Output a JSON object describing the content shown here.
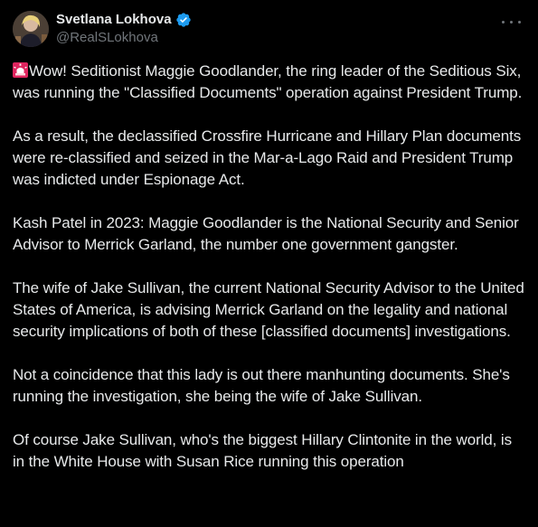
{
  "author": {
    "display_name": "Svetlana Lokhova",
    "handle": "@RealSLokhova",
    "verified": true,
    "avatar_icon": "profile-photo-icon",
    "verified_icon": "verified-badge-icon"
  },
  "menu": {
    "icon": "more-options-icon"
  },
  "colors": {
    "background": "#000000",
    "text": "#e7e9ea",
    "secondary_text": "#71767b",
    "verified_blue": "#1d9bf0",
    "siren_red": "#e0245e"
  },
  "tweet": {
    "lead_icon": "siren-icon",
    "paragraphs": [
      "Wow! Seditionist Maggie Goodlander, the ring leader of the Seditious Six, was running the \"Classified Documents\" operation against President Trump.",
      "As a result, the declassified Crossfire Hurricane and Hillary Plan documents were re-classified and seized in the Mar-a-Lago Raid and President Trump was indicted under Espionage Act.",
      "Kash Patel in 2023: Maggie Goodlander is the National Security and Senior Advisor to Merrick Garland, the number one government gangster.",
      "The wife of Jake Sullivan, the current National Security Advisor to the United States of America, is advising Merrick Garland on the legality and national security implications of both of these [classified documents] investigations.",
      "Not a coincidence that this lady is out there manhunting documents. She's running the investigation, she being the wife of Jake Sullivan.",
      "Of course Jake Sullivan, who's the biggest Hillary Clintonite in the world, is in the White House with Susan Rice running this operation"
    ]
  }
}
